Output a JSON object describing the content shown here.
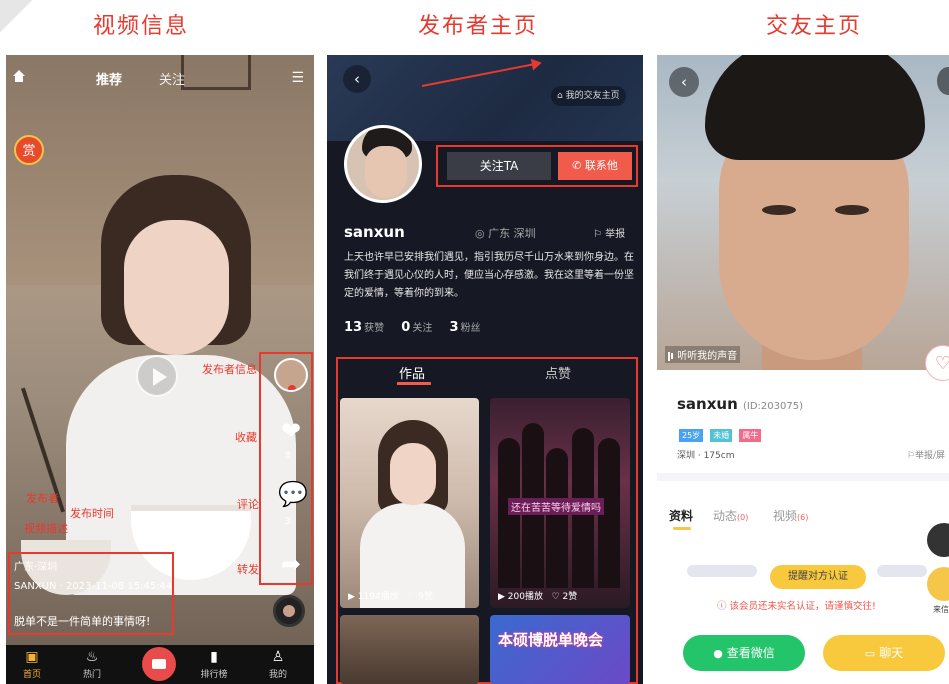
{
  "titles": [
    "视频信息",
    "发布者主页",
    "交友主页"
  ],
  "video": {
    "tabs": [
      "推荐",
      "关注"
    ],
    "reward_icon": "赏",
    "annotations": {
      "publisher_info": "发布者信息",
      "favorite": "收藏",
      "comment": "评论",
      "share": "转发",
      "left": [
        "发布者",
        "发布时间",
        "视频描述"
      ]
    },
    "counts": {
      "like": "8",
      "comment": "3"
    },
    "location": "广东·深圳",
    "publisher_time": "SANXUN · 2023-11-08 15:45:44",
    "description": "脱单不是一件简单的事情呀!",
    "bottom_nav": [
      "首页",
      "热门",
      "",
      "排行榜",
      "我的"
    ]
  },
  "publisher": {
    "dating_link": "我的交友主页",
    "follow_label": "关注TA",
    "contact_label": "联系他",
    "username": "sanxun",
    "location": "广东 深圳",
    "report": "举报",
    "bio": "上天也许早已安排我们遇见，指引我历尽千山万水来到你身边。在我们终于遇见心仪的人时，便应当心存感激。我在这里等着一份坚定的爱情，等着你的到来。",
    "stats": {
      "likes_n": "13",
      "likes_l": "获赞",
      "follow_n": "0",
      "follow_l": "关注",
      "fans_n": "3",
      "fans_l": "粉丝"
    },
    "tabs": [
      "作品",
      "点赞"
    ],
    "thumbs": [
      {
        "plays": "1194播放",
        "likes": "9赞"
      },
      {
        "plays": "200播放",
        "likes": "2赞",
        "tag": "还在苦苦等待爱情吗"
      },
      {
        "tag": "本硕博脱单晚会"
      }
    ]
  },
  "dating": {
    "voice": "听听我的声音",
    "username": "sanxun",
    "uid": "(ID:203075)",
    "badges": [
      "25岁",
      "未婚",
      "属牛"
    ],
    "city": "深圳 · 175cm",
    "report": "举报/屏",
    "tabs": [
      {
        "label": "资料",
        "count": ""
      },
      {
        "label": "动态",
        "count": "(0)"
      },
      {
        "label": "视频",
        "count": "(6)"
      }
    ],
    "verify_label": "提醒对方认证",
    "warning": "ⓘ 该会员还未实名认证，请谨慎交往!",
    "side_label": "来信",
    "wechat_label": "查看微信",
    "chat_label": "聊天"
  }
}
